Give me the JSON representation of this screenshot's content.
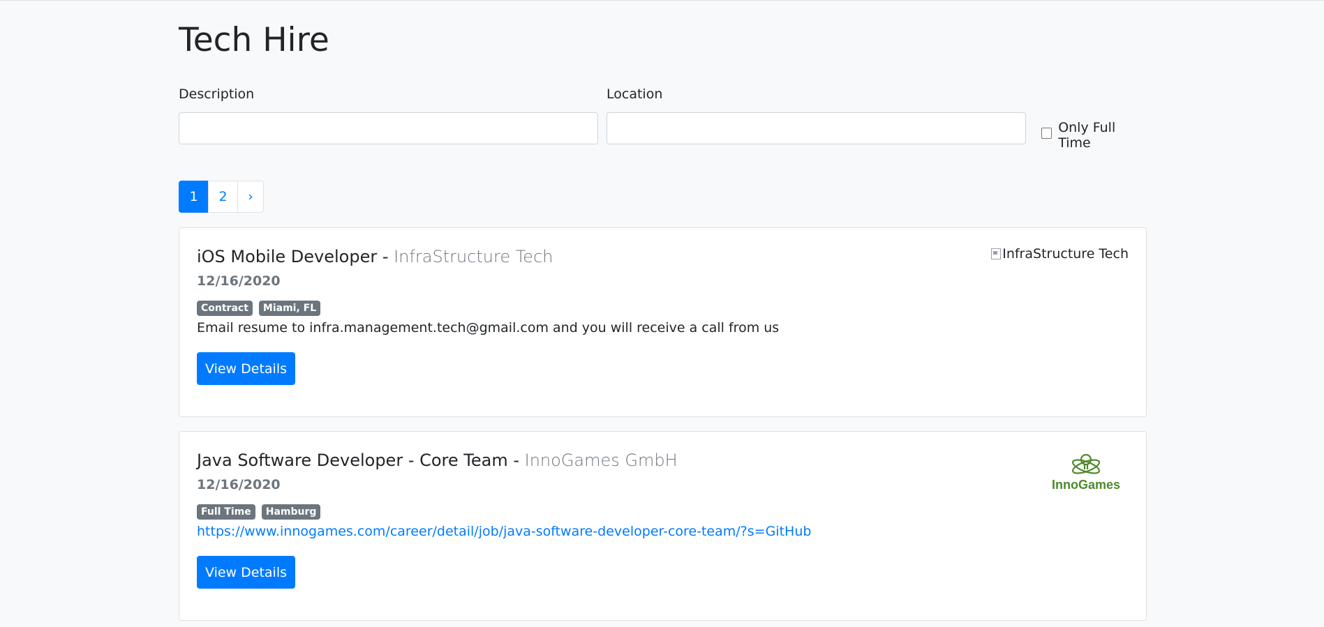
{
  "app": {
    "title": "Tech Hire"
  },
  "search": {
    "description_label": "Description",
    "description_value": "",
    "location_label": "Location",
    "location_value": "",
    "fulltime_label": "Only Full Time",
    "fulltime_checked": false
  },
  "pagination": {
    "pages": [
      "1",
      "2"
    ],
    "active": "1",
    "next": "›"
  },
  "jobs": [
    {
      "title": "iOS Mobile Developer - ",
      "company": "InfraStructure Tech",
      "date": "12/16/2020",
      "type": "Contract",
      "location": "Miami, FL",
      "description": "Email resume to infra.management.tech@gmail.com and you will receive a call from us",
      "button": "View Details",
      "logo_alt": "InfraStructure Tech"
    },
    {
      "title": "Java Software Developer - Core Team - ",
      "company": "InnoGames GmbH",
      "date": "12/16/2020",
      "type": "Full Time",
      "location": "Hamburg",
      "description": "https://www.innogames.com/career/detail/job/java-software-developer-core-team/?s=GitHub",
      "button": "View Details",
      "logo_text": "InnoGames"
    }
  ],
  "colors": {
    "primary": "#007bff",
    "badge": "#6c757d",
    "background": "#f8f9fa",
    "innogames_green": "#4e8a2a"
  }
}
